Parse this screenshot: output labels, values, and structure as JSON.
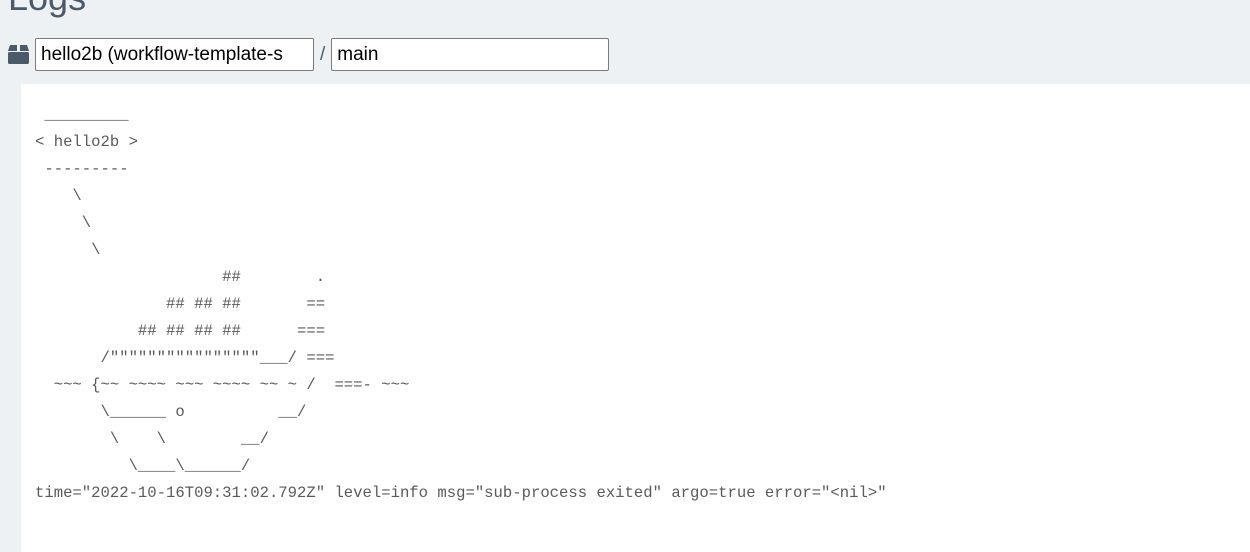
{
  "page": {
    "title": "Logs"
  },
  "selectors": {
    "pod_icon": "cube-icon",
    "pod_value": "hello2b (workflow-template-s",
    "separator": "/",
    "container_value": "main"
  },
  "logs": {
    "lines": [
      " _________",
      "< hello2b >",
      " ---------",
      "    \\",
      "     \\",
      "      \\",
      "                    ##        .",
      "              ## ## ##       ==",
      "           ## ## ## ##      ===",
      "       /\"\"\"\"\"\"\"\"\"\"\"\"\"\"\"\"___/ ===",
      "  ~~~ {~~ ~~~~ ~~~ ~~~~ ~~ ~ /  ===- ~~~",
      "       \\______ o          __/",
      "        \\    \\        __/",
      "          \\____\\______/",
      "time=\"2022-10-16T09:31:02.792Z\" level=info msg=\"sub-process exited\" argo=true error=\"<nil>\""
    ]
  }
}
